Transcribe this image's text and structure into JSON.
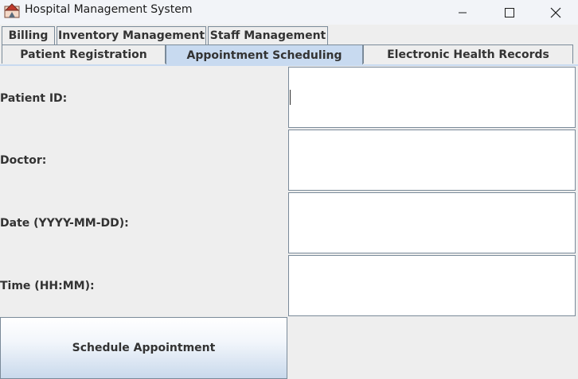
{
  "window": {
    "title": "Hospital Management System",
    "icon": "java-app-icon",
    "controls": [
      "minimize",
      "maximize",
      "close"
    ]
  },
  "tabs": {
    "row_top": [
      {
        "label": "Billing"
      },
      {
        "label": "Inventory Management"
      },
      {
        "label": "Staff Management"
      }
    ],
    "row_bottom": [
      {
        "label": "Patient Registration"
      },
      {
        "label": "Appointment Scheduling",
        "selected": true
      },
      {
        "label": "Electronic Health Records"
      }
    ]
  },
  "form": {
    "patient_id_label": "Patient ID:",
    "doctor_label": "Doctor:",
    "date_label": "Date (YYYY-MM-DD):",
    "time_label": "Time (HH:MM):",
    "patient_id_value": "",
    "doctor_value": "",
    "date_value": "",
    "time_value": "",
    "submit_label": "Schedule Appointment"
  },
  "colors": {
    "selected_tab": "#c8daf0",
    "border": "#7a8a99",
    "background": "#eeeeee"
  }
}
